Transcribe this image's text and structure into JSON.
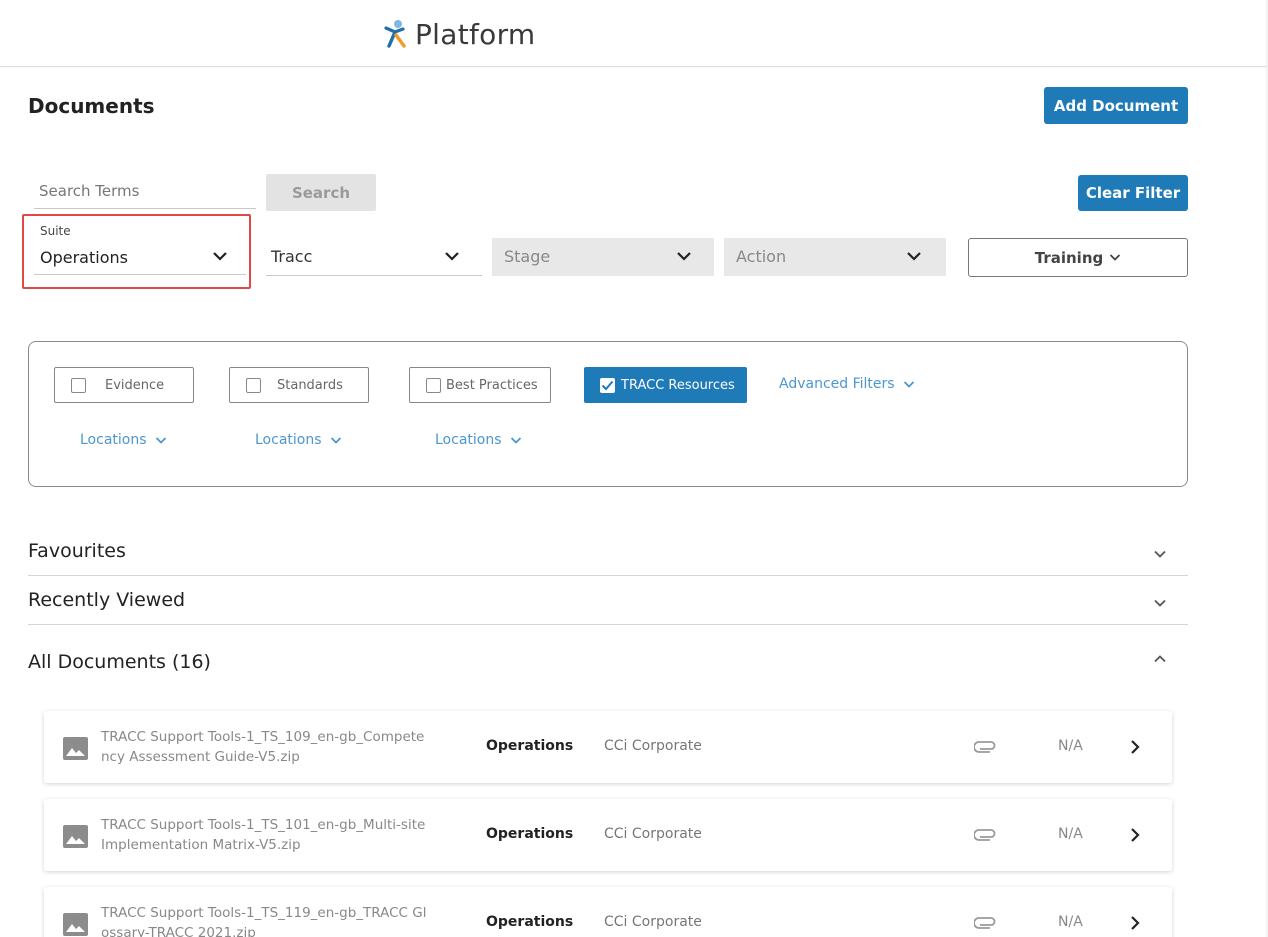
{
  "header": {
    "app_name": "Platform",
    "logo_icon": "person-figure-logo-icon"
  },
  "page": {
    "title": "Documents",
    "add_document_label": "Add Document"
  },
  "search": {
    "placeholder": "Search Terms",
    "value": "",
    "button_label": "Search",
    "clear_filter_label": "Clear Filter"
  },
  "filters": {
    "suite_label": "Suite",
    "suite_value": "Operations",
    "tracc_value": "Tracc",
    "stage_value": "Stage",
    "action_value": "Action",
    "training_label": "Training"
  },
  "filter_panel": {
    "evidence_label": "Evidence",
    "evidence_checked": false,
    "standards_label": "Standards",
    "standards_checked": false,
    "best_practices_label": "Best Practices",
    "best_practices_checked": false,
    "tracc_resources_label": "TRACC Resources",
    "tracc_resources_checked": true,
    "advanced_filters_label": "Advanced Filters",
    "locations_label": "Locations"
  },
  "sections": {
    "favourites": "Favourites",
    "recently_viewed": "Recently Viewed",
    "all_documents": "All Documents (16)"
  },
  "documents": [
    {
      "name": "TRACC Support Tools-1_TS_109_en-gb_Competency Assessment Guide-V5.zip",
      "suite": "Operations",
      "owner": "CCi Corporate",
      "status": "N/A"
    },
    {
      "name": "TRACC Support Tools-1_TS_101_en-gb_Multi-site Implementation Matrix-V5.zip",
      "suite": "Operations",
      "owner": "CCi Corporate",
      "status": "N/A"
    },
    {
      "name": "TRACC Support Tools-1_TS_119_en-gb_TRACC Glossary-TRACC 2021.zip",
      "suite": "Operations",
      "owner": "CCi Corporate",
      "status": "N/A"
    }
  ],
  "colors": {
    "primary": "#1f7ab8",
    "link": "#4c97cf",
    "highlight": "#e04848"
  }
}
